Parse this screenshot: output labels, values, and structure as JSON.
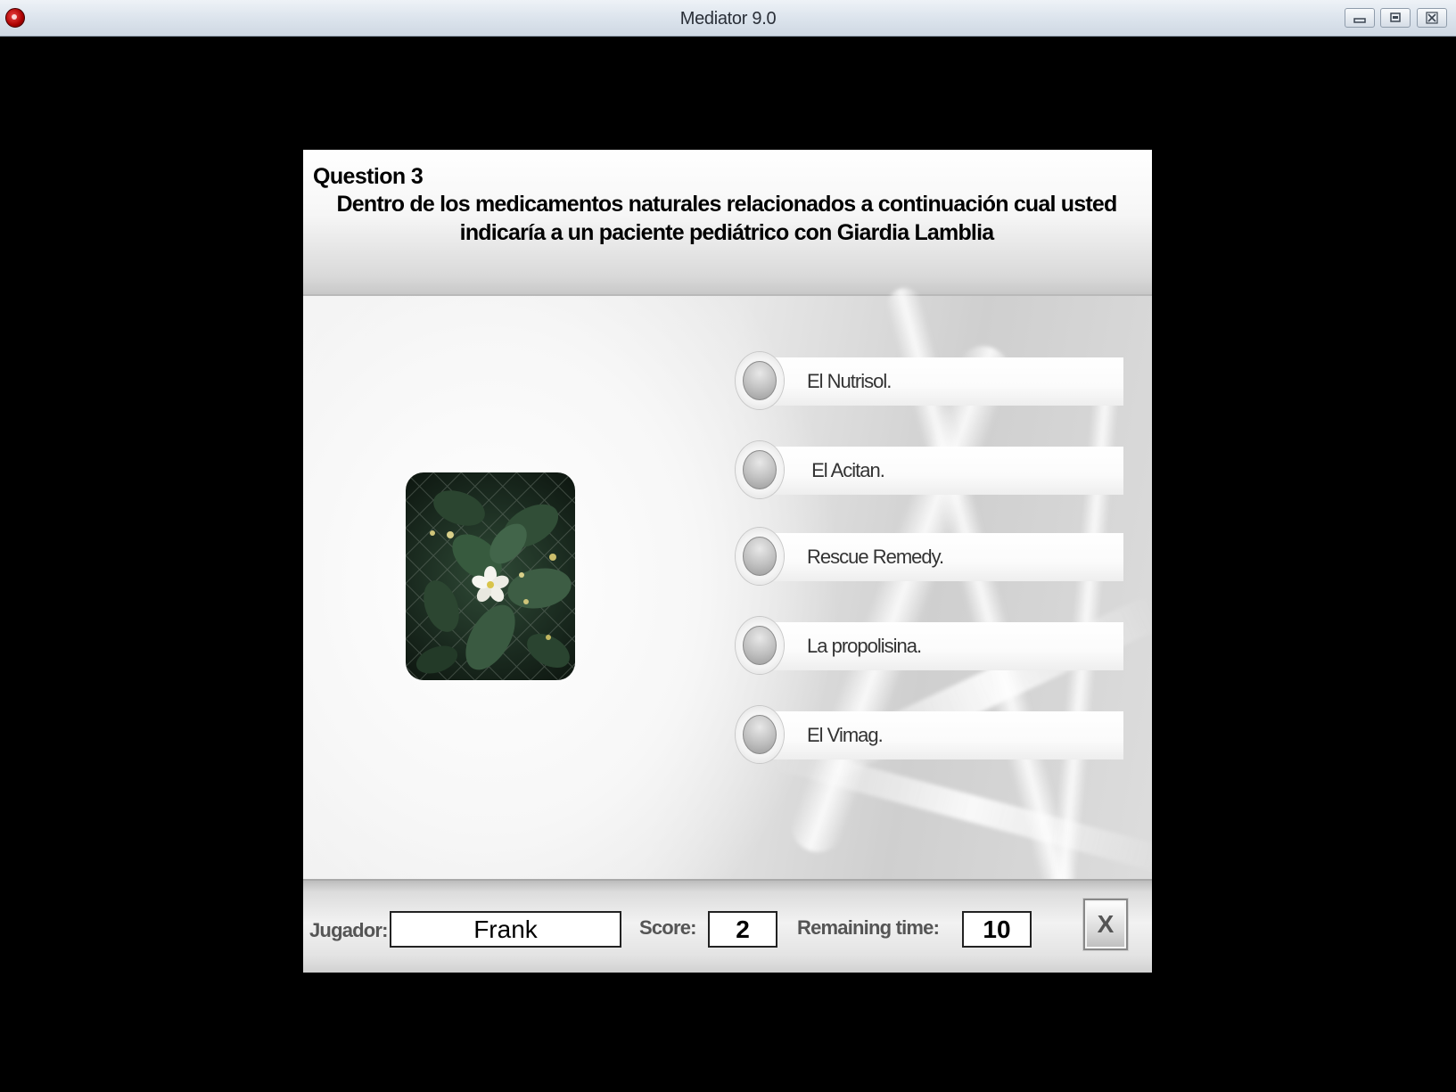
{
  "window": {
    "title": "Mediator 9.0",
    "icons": {
      "app": "app-logo-icon",
      "minimize": "minimize-icon",
      "maximize": "maximize-icon",
      "close": "close-icon"
    }
  },
  "question": {
    "number_label": "Question 3",
    "text": "Dentro de los medicamentos naturales relacionados a continuación cual usted indicaría a un paciente pediátrico con Giardia Lamblia"
  },
  "answers": [
    {
      "label": "El Nutrisol."
    },
    {
      "label": " El Acitan."
    },
    {
      "label": "Rescue Remedy."
    },
    {
      "label": "La propolisina."
    },
    {
      "label": "El Vimag."
    }
  ],
  "footer": {
    "player_label": "Jugador:",
    "player_value": "Frank",
    "score_label": "Score:",
    "score_value": "2",
    "time_label": "Remaining time:",
    "time_value": "10",
    "close_label": "X"
  },
  "colors": {
    "titlebar": "#dbe3ec",
    "background": "#000000",
    "panel": "#f4f4f4"
  }
}
